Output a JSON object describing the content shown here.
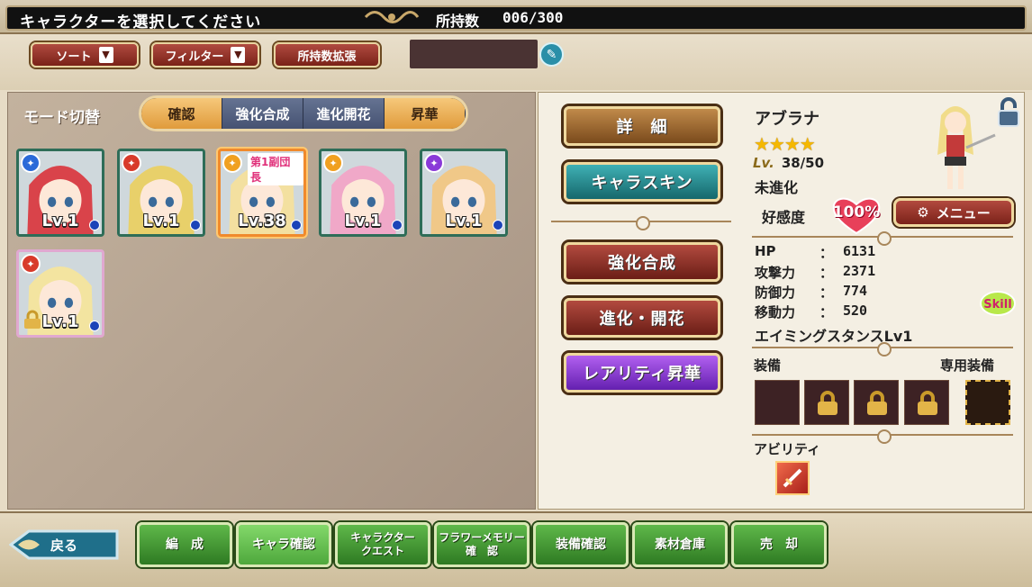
{
  "header": {
    "title": "キャラクターを選択してください",
    "count_label": "所持数",
    "count_value": "006/300"
  },
  "toolbar": {
    "sort_label": "ソート",
    "filter_label": "フィルター",
    "expand_label": "所持数拡張",
    "dropdown_arrow": "▼",
    "edit_icon": "pencil-icon"
  },
  "mode": {
    "label": "モード切替",
    "tabs": [
      {
        "label": "確認",
        "selected": true
      },
      {
        "label": "強化合成",
        "selected": false
      },
      {
        "label": "進化開花",
        "selected": false
      },
      {
        "label": "昇華",
        "selected": false
      }
    ]
  },
  "characters": [
    {
      "level": "Lv.1",
      "element": "blue",
      "hair": "#d9434a",
      "frame": "#2e6d58",
      "selected": false,
      "locked": false
    },
    {
      "level": "Lv.1",
      "element": "red",
      "hair": "#e8d06a",
      "frame": "#2e6d58",
      "selected": false,
      "locked": false
    },
    {
      "level": "Lv.38",
      "element": "orange",
      "hair": "#f3e0a0",
      "frame": "#f08a2c",
      "selected": true,
      "locked": false,
      "badge": "第1副団長"
    },
    {
      "level": "Lv.1",
      "element": "orange",
      "hair": "#f0a8c8",
      "frame": "#2e6d58",
      "selected": false,
      "locked": false
    },
    {
      "level": "Lv.1",
      "element": "purple",
      "hair": "#f0c888",
      "frame": "#2e6d58",
      "selected": false,
      "locked": false
    },
    {
      "level": "Lv.1",
      "element": "red",
      "hair": "#f3e4a0",
      "frame": "#e0a8d0",
      "selected": false,
      "locked": true
    }
  ],
  "actions": {
    "detail": "詳　細",
    "skin": "キャラスキン",
    "enhance": "強化合成",
    "evolve": "進化・開花",
    "rarity": "レアリティ昇華"
  },
  "detail": {
    "name": "アブラナ",
    "stars": "★★★★",
    "lv_mark": "Lv.",
    "level": "38/50",
    "evolution": "未進化",
    "affection_label": "好感度",
    "affection_value": "100%",
    "menu_label": "メニュー",
    "stats": [
      {
        "label": "HP",
        "value": "6131"
      },
      {
        "label": "攻撃力",
        "value": "2371"
      },
      {
        "label": "防御力",
        "value": "774"
      },
      {
        "label": "移動力",
        "value": "520"
      }
    ],
    "colon": "：",
    "skill_badge": "Skill",
    "skill_name": "エイミングスタンスLv1",
    "equip_label": "装備",
    "exclusive_label": "専用装備",
    "ability_label": "アビリティ"
  },
  "nav": {
    "back": "戻る",
    "items": [
      {
        "label": "編　成"
      },
      {
        "label": "キャラ確認"
      },
      {
        "label": "キャラクター\nクエスト"
      },
      {
        "label": "フラワーメモリー\n確　認"
      },
      {
        "label": "装備確認"
      },
      {
        "label": "素材倉庫"
      },
      {
        "label": "売　却"
      }
    ]
  },
  "colors": {
    "accent_orange": "#f08a2c",
    "nav_green": "#3f9a30",
    "button_red": "#8a2a20",
    "button_teal": "#1f7f84",
    "button_purple": "#7a2ad0"
  }
}
